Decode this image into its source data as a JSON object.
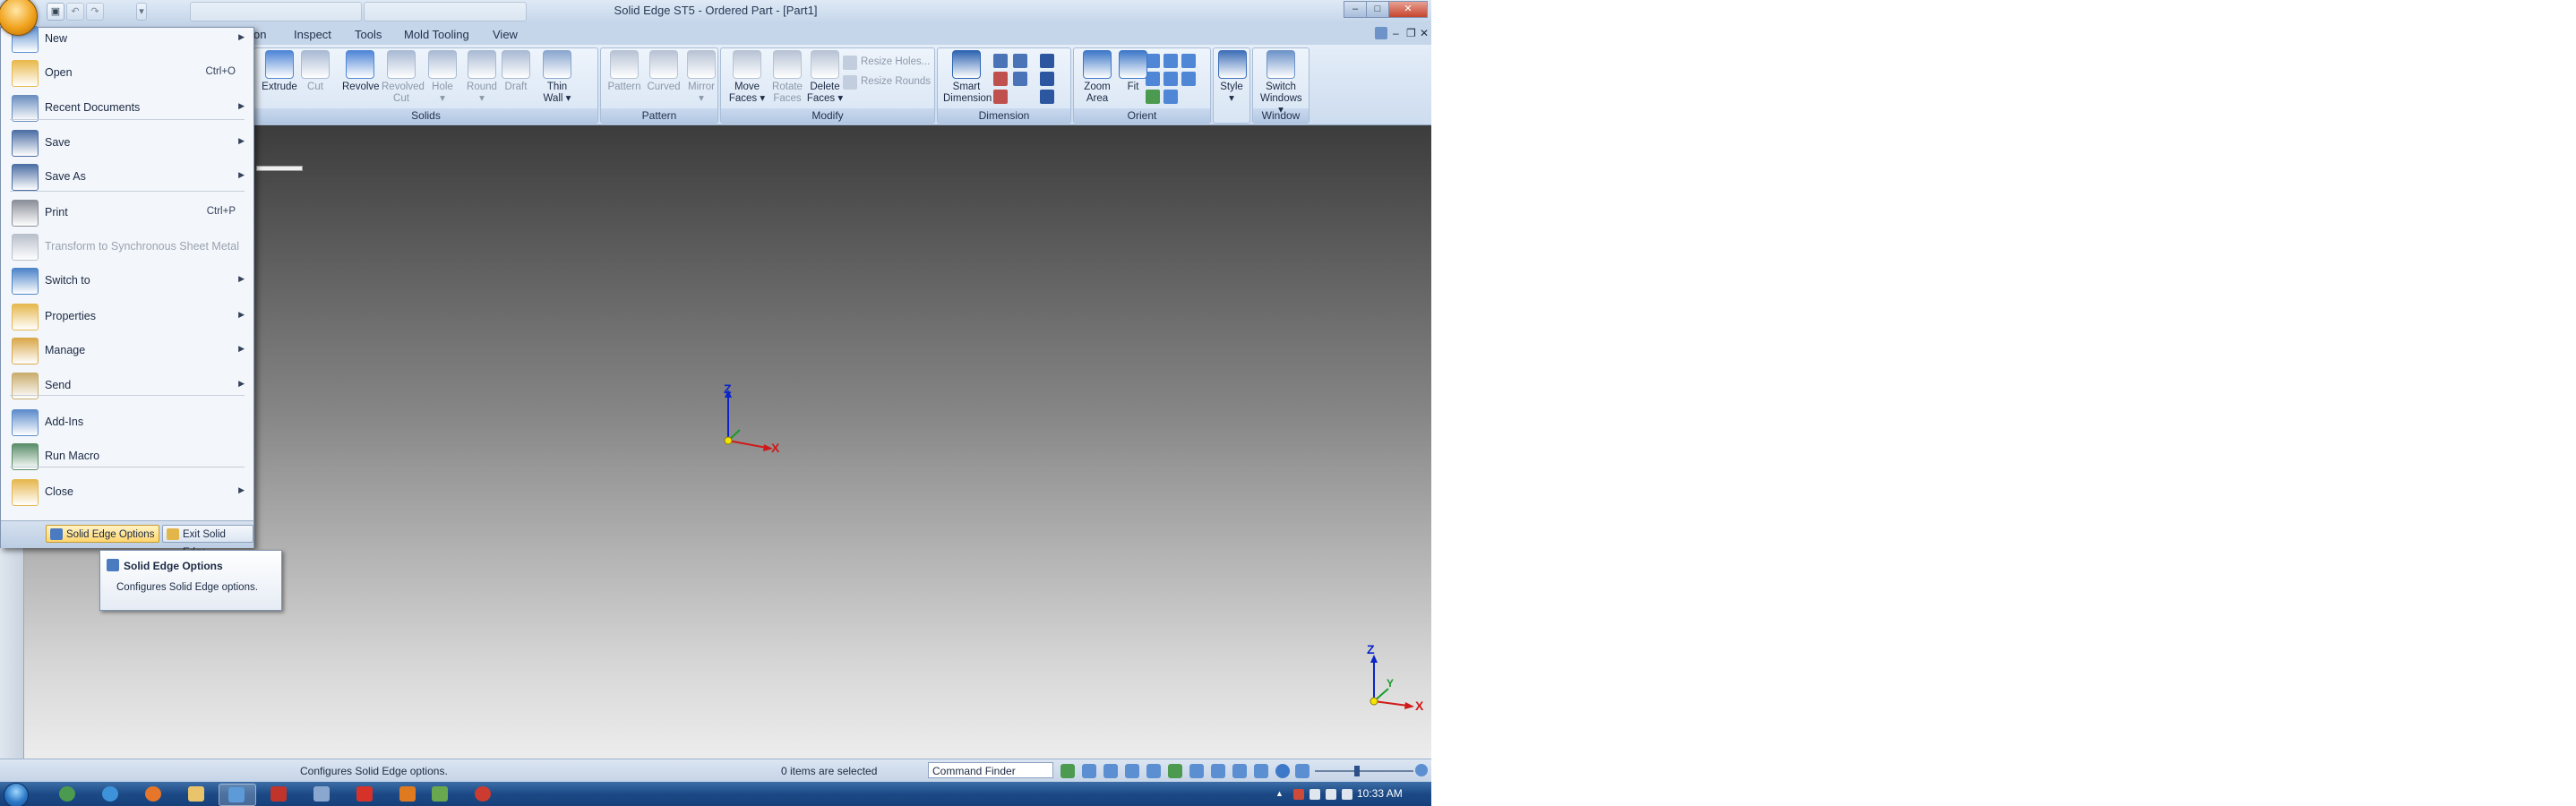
{
  "window": {
    "title": "Solid Edge ST5 - Ordered Part - [Part1]",
    "controls": {
      "min": "–",
      "max": "□",
      "close": "✕"
    },
    "doc_controls": {
      "min": "–",
      "restore": "❐",
      "close": "✕"
    }
  },
  "tabs": [
    {
      "label": "on"
    },
    {
      "label": "Inspect"
    },
    {
      "label": "Tools"
    },
    {
      "label": "Mold Tooling"
    },
    {
      "label": "View"
    }
  ],
  "ribbon": {
    "groups": [
      {
        "title": "Solids",
        "buttons": [
          {
            "line1": "Extrude",
            "line2": "",
            "disabled": false,
            "icon": "extrude-icon",
            "color": "#4f86d6"
          },
          {
            "line1": "Cut",
            "line2": "",
            "disabled": true,
            "icon": "cut-icon",
            "color": "#a9bad3"
          },
          {
            "line1": "Revolve",
            "line2": "",
            "disabled": false,
            "icon": "revolve-icon",
            "color": "#4f86d6"
          },
          {
            "line1": "Revolved",
            "line2": "Cut",
            "disabled": true,
            "icon": "revolved-cut-icon",
            "color": "#a9bad3"
          },
          {
            "line1": "Hole",
            "line2": "▾",
            "disabled": true,
            "icon": "hole-icon",
            "color": "#a9bad3"
          },
          {
            "line1": "Round",
            "line2": "▾",
            "disabled": true,
            "icon": "round-icon",
            "color": "#a9bad3"
          },
          {
            "line1": "Draft",
            "line2": "",
            "disabled": true,
            "icon": "draft-icon",
            "color": "#a9bad3"
          },
          {
            "line1": "Thin",
            "line2": "Wall ▾",
            "disabled": false,
            "icon": "thin-wall-icon",
            "color": "#8aa7cf"
          }
        ]
      },
      {
        "title": "Pattern",
        "buttons": [
          {
            "line1": "Pattern",
            "line2": "",
            "disabled": true,
            "icon": "pattern-icon",
            "color": "#b7c3d4"
          },
          {
            "line1": "Curved",
            "line2": "",
            "disabled": true,
            "icon": "curved-icon",
            "color": "#b7c3d4"
          },
          {
            "line1": "Mirror",
            "line2": "▾",
            "disabled": true,
            "icon": "mirror-icon",
            "color": "#b7c3d4"
          }
        ]
      },
      {
        "title": "Modify",
        "buttons": [
          {
            "line1": "Move",
            "line2": "Faces ▾",
            "disabled": false,
            "icon": "move-faces-icon",
            "color": "#b7c3d4"
          },
          {
            "line1": "Rotate",
            "line2": "Faces",
            "disabled": true,
            "icon": "rotate-faces-icon",
            "color": "#b7c3d4"
          },
          {
            "line1": "Delete",
            "line2": "Faces ▾",
            "disabled": false,
            "icon": "delete-faces-icon",
            "color": "#b7c3d4"
          }
        ],
        "small": [
          "Resize Holes...",
          "Resize Rounds"
        ]
      },
      {
        "title": "Dimension",
        "buttons": [
          {
            "line1": "Smart",
            "line2": "Dimension",
            "disabled": false,
            "icon": "smart-dimension-icon",
            "color": "#2f64b3"
          }
        ]
      },
      {
        "title": "Orient",
        "buttons": [
          {
            "line1": "Zoom",
            "line2": "Area",
            "disabled": false,
            "icon": "zoom-area-icon",
            "color": "#3e78c8"
          },
          {
            "line1": "Fit",
            "line2": "",
            "disabled": false,
            "icon": "fit-icon",
            "color": "#3e78c8"
          }
        ]
      },
      {
        "title": "",
        "buttons": [
          {
            "line1": "Style",
            "line2": "▾",
            "disabled": false,
            "icon": "style-icon",
            "color": "#3f6fb8"
          }
        ]
      },
      {
        "title": "Window",
        "buttons": [
          {
            "line1": "Switch",
            "line2": "Windows ▾",
            "disabled": false,
            "icon": "switch-windows-icon",
            "color": "#6d93c9"
          }
        ]
      }
    ]
  },
  "app_menu": {
    "items": [
      {
        "label": "New",
        "shortcut": "",
        "arrow": "▶",
        "disabled": false,
        "icon": "new-document-icon",
        "color": "#5b8fd1"
      },
      {
        "label": "Open",
        "shortcut": "Ctrl+O",
        "arrow": "",
        "disabled": false,
        "icon": "open-folder-icon",
        "color": "#e9b94c"
      },
      {
        "label": "Recent Documents",
        "shortcut": "",
        "arrow": "▶",
        "disabled": false,
        "icon": "recent-documents-icon",
        "color": "#6c8fbf"
      },
      {
        "label": "Save",
        "shortcut": "",
        "arrow": "▶",
        "disabled": false,
        "icon": "save-disk-icon",
        "color": "#4e6fa5"
      },
      {
        "label": "Save As",
        "shortcut": "",
        "arrow": "▶",
        "disabled": false,
        "icon": "save-as-icon",
        "color": "#4e6fa5"
      },
      {
        "label": "Print",
        "shortcut": "Ctrl+P",
        "arrow": "",
        "disabled": false,
        "icon": "printer-icon",
        "color": "#8b8f99"
      },
      {
        "label": "Transform to Synchronous Sheet Metal",
        "shortcut": "",
        "arrow": "",
        "disabled": true,
        "icon": "transform-sheet-metal-icon",
        "color": "#b9c0cb"
      },
      {
        "label": "Switch to",
        "shortcut": "",
        "arrow": "▶",
        "disabled": false,
        "icon": "switch-to-icon",
        "color": "#4d84c9"
      },
      {
        "label": "Properties",
        "shortcut": "",
        "arrow": "▶",
        "disabled": false,
        "icon": "properties-folder-icon",
        "color": "#e6b84f"
      },
      {
        "label": "Manage",
        "shortcut": "",
        "arrow": "▶",
        "disabled": false,
        "icon": "manage-icon",
        "color": "#d9a84a"
      },
      {
        "label": "Send",
        "shortcut": "",
        "arrow": "▶",
        "disabled": false,
        "icon": "send-envelope-icon",
        "color": "#c9ad6e"
      },
      {
        "label": "Add-Ins",
        "shortcut": "",
        "arrow": "",
        "disabled": false,
        "icon": "add-ins-icon",
        "color": "#5d8ccb"
      },
      {
        "label": "Run Macro",
        "shortcut": "",
        "arrow": "",
        "disabled": false,
        "icon": "run-macro-icon",
        "color": "#5a8e6a"
      },
      {
        "label": "Close",
        "shortcut": "",
        "arrow": "▶",
        "disabled": false,
        "icon": "close-folder-icon",
        "color": "#e6b84f"
      }
    ],
    "footer": {
      "options_label": "Solid Edge Options",
      "exit_label": "Exit Solid Edge"
    }
  },
  "tooltip": {
    "title": "Solid Edge Options",
    "description": "Configures Solid Edge options."
  },
  "viewport": {
    "axis_z": "Z",
    "axis_x": "X",
    "axis_y": "Y"
  },
  "status": {
    "prompt": "Configures Solid Edge options.",
    "selection": "0 items are selected",
    "command_finder": "Command Finder"
  },
  "taskbar": {
    "clock": "10:33 AM"
  },
  "colors": {
    "accent_orange": "#f0a21c",
    "ribbon_blue": "#cddcef",
    "taskbar": "#1c4a86"
  }
}
